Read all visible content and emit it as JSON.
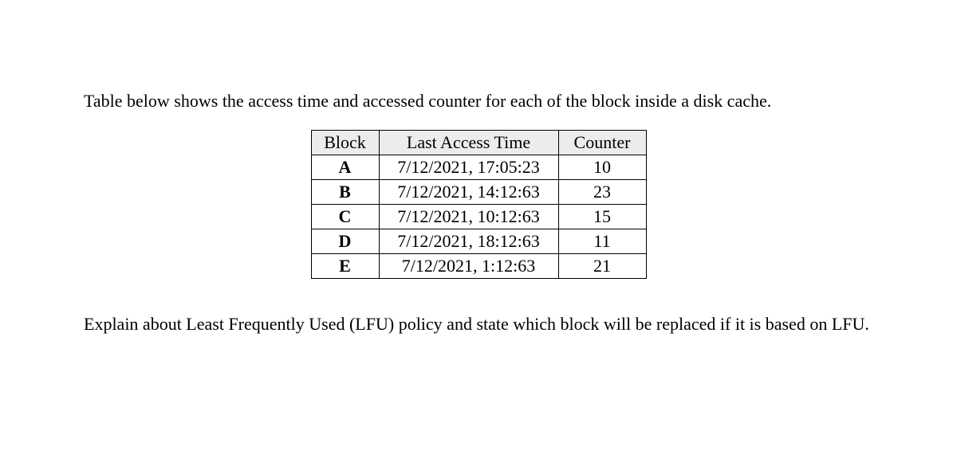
{
  "intro": "Table below shows the access time and accessed counter for each of the block inside a disk cache.",
  "table": {
    "headers": {
      "block": "Block",
      "lat": "Last Access Time",
      "counter": "Counter"
    },
    "rows": [
      {
        "block": "A",
        "lat": "7/12/2021, 17:05:23",
        "counter": "10"
      },
      {
        "block": "B",
        "lat": "7/12/2021, 14:12:63",
        "counter": "23"
      },
      {
        "block": "C",
        "lat": "7/12/2021, 10:12:63",
        "counter": "15"
      },
      {
        "block": "D",
        "lat": "7/12/2021, 18:12:63",
        "counter": "11"
      },
      {
        "block": "E",
        "lat": "7/12/2021, 1:12:63",
        "counter": "21"
      }
    ]
  },
  "question": "Explain about Least Frequently Used (LFU) policy and state which block will be replaced if it is based on LFU."
}
